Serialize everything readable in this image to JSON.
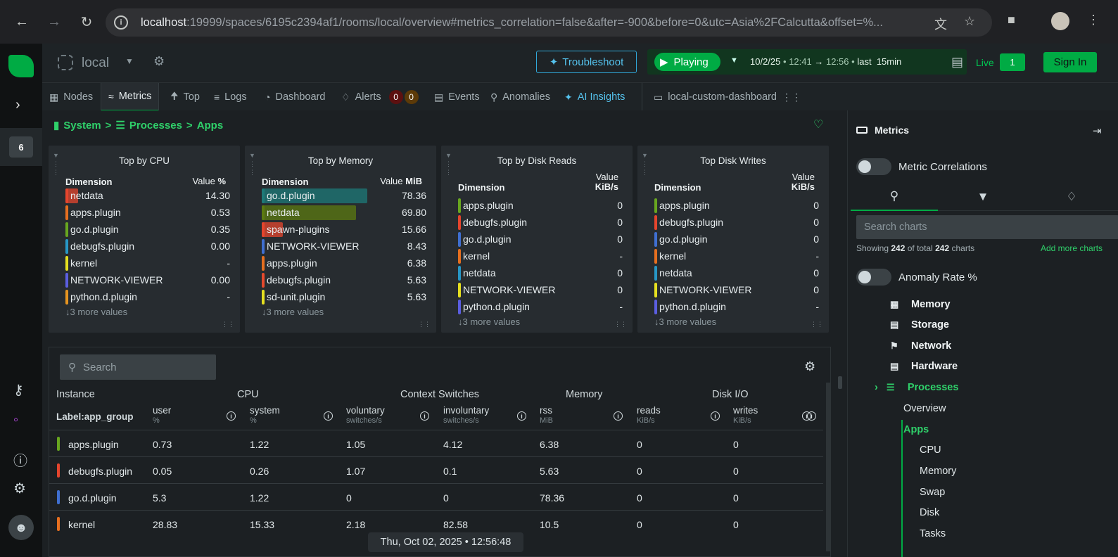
{
  "browser": {
    "url_host": "localhost",
    "url_rest": ":19999/spaces/6195c2394af1/rooms/local/overview#metrics_correlation=false&after=-900&before=0&utc=Asia%2FCalcutta&offset=%..."
  },
  "rail": {
    "badge": "6"
  },
  "header": {
    "space_name": "local",
    "troubleshoot": "Troubleshoot",
    "playing": "Playing",
    "range_date": "10/2/25",
    "range_from": "12:41",
    "range_to": "12:56",
    "range_last": "last",
    "range_dur": "15min",
    "live": "Live",
    "live_count": "1",
    "signin": "Sign In"
  },
  "tabs": [
    {
      "label": "Nodes"
    },
    {
      "label": "Metrics"
    },
    {
      "label": "Top"
    },
    {
      "label": "Logs"
    },
    {
      "label": "Dashboard"
    },
    {
      "label": "Alerts"
    },
    {
      "label": "Events"
    },
    {
      "label": "Anomalies"
    },
    {
      "label": "AI Insights"
    },
    {
      "label": "local-custom-dashboard"
    }
  ],
  "alerts": {
    "critical": "0",
    "warning": "0"
  },
  "breadcrumb": {
    "a": "System",
    "b": "Processes",
    "c": "Apps",
    "sep": ">"
  },
  "cards": [
    {
      "title": "Top by CPU",
      "dim": "Dimension",
      "val": "Value",
      "unit": "%",
      "more": "↓3 more values",
      "rows": [
        {
          "name": "netdata",
          "value": "14.30",
          "color": "#e5452d",
          "fill": 0.12
        },
        {
          "name": "apps.plugin",
          "value": "0.53",
          "color": "#e66f1f",
          "fill": 0
        },
        {
          "name": "go.d.plugin",
          "value": "0.35",
          "color": "#68a61f",
          "fill": 0
        },
        {
          "name": "debugfs.plugin",
          "value": "0.00",
          "color": "#2797c6",
          "fill": 0
        },
        {
          "name": "kernel",
          "value": "-",
          "color": "#e6e020",
          "fill": 0
        },
        {
          "name": "NETWORK-VIEWER",
          "value": "0.00",
          "color": "#5b5ee0",
          "fill": 0
        },
        {
          "name": "python.d.plugin",
          "value": "-",
          "color": "#e69420",
          "fill": 0
        }
      ]
    },
    {
      "title": "Top by Memory",
      "dim": "Dimension",
      "val": "Value",
      "unit": "MiB",
      "more": "↓3 more values",
      "rows": [
        {
          "name": "go.d.plugin",
          "value": "78.36",
          "color": "#1e7a78",
          "fill": 1.0
        },
        {
          "name": "netdata",
          "value": "69.80",
          "color": "#5c7a10",
          "fill": 0.89
        },
        {
          "name": "spawn-plugins",
          "value": "15.66",
          "color": "#e5452d",
          "fill": 0.2
        },
        {
          "name": "NETWORK-VIEWER",
          "value": "8.43",
          "color": "#3f6fd1",
          "fill": 0
        },
        {
          "name": "apps.plugin",
          "value": "6.38",
          "color": "#e66f1f",
          "fill": 0
        },
        {
          "name": "debugfs.plugin",
          "value": "5.63",
          "color": "#e64a2d",
          "fill": 0
        },
        {
          "name": "sd-unit.plugin",
          "value": "5.63",
          "color": "#e6e020",
          "fill": 0
        }
      ]
    },
    {
      "title": "Top by Disk Reads",
      "dim": "Dimension",
      "val": "Value",
      "unit": "KiB/s",
      "more": "↓3 more values",
      "rows": [
        {
          "name": "apps.plugin",
          "value": "0",
          "color": "#68a61f",
          "fill": 0
        },
        {
          "name": "debugfs.plugin",
          "value": "0",
          "color": "#e5452d",
          "fill": 0
        },
        {
          "name": "go.d.plugin",
          "value": "0",
          "color": "#3f6fd1",
          "fill": 0
        },
        {
          "name": "kernel",
          "value": "-",
          "color": "#e66f1f",
          "fill": 0
        },
        {
          "name": "netdata",
          "value": "0",
          "color": "#2797c6",
          "fill": 0
        },
        {
          "name": "NETWORK-VIEWER",
          "value": "0",
          "color": "#e6e020",
          "fill": 0
        },
        {
          "name": "python.d.plugin",
          "value": "-",
          "color": "#5b5ee0",
          "fill": 0
        }
      ]
    },
    {
      "title": "Top Disk Writes",
      "dim": "Dimension",
      "val": "Value",
      "unit": "KiB/s",
      "more": "↓3 more values",
      "rows": [
        {
          "name": "apps.plugin",
          "value": "0",
          "color": "#68a61f",
          "fill": 0
        },
        {
          "name": "debugfs.plugin",
          "value": "0",
          "color": "#e5452d",
          "fill": 0
        },
        {
          "name": "go.d.plugin",
          "value": "0",
          "color": "#3f6fd1",
          "fill": 0
        },
        {
          "name": "kernel",
          "value": "-",
          "color": "#e66f1f",
          "fill": 0
        },
        {
          "name": "netdata",
          "value": "0",
          "color": "#2797c6",
          "fill": 0
        },
        {
          "name": "NETWORK-VIEWER",
          "value": "0",
          "color": "#e6e020",
          "fill": 0
        },
        {
          "name": "python.d.plugin",
          "value": "-",
          "color": "#5b5ee0",
          "fill": 0
        }
      ]
    }
  ],
  "table": {
    "search_placeholder": "Search",
    "groups": [
      "Instance",
      "CPU",
      "Context Switches",
      "Memory",
      "Disk I/O"
    ],
    "label_col": "Label:app_group",
    "cols": [
      {
        "name": "user",
        "unit": "%"
      },
      {
        "name": "system",
        "unit": "%"
      },
      {
        "name": "voluntary",
        "unit": "switches/s"
      },
      {
        "name": "involuntary",
        "unit": "switches/s"
      },
      {
        "name": "rss",
        "unit": "MiB"
      },
      {
        "name": "reads",
        "unit": "KiB/s"
      },
      {
        "name": "writes",
        "unit": "KiB/s"
      }
    ],
    "rows": [
      {
        "name": "apps.plugin",
        "color": "#68a61f",
        "cells": [
          "0.73",
          "1.22",
          "1.05",
          "4.12",
          "6.38",
          "0",
          "0"
        ]
      },
      {
        "name": "debugfs.plugin",
        "color": "#e5452d",
        "cells": [
          "0.05",
          "0.26",
          "1.07",
          "0.1",
          "5.63",
          "0",
          "0"
        ]
      },
      {
        "name": "go.d.plugin",
        "color": "#3f6fd1",
        "cells": [
          "5.3",
          "1.22",
          "0",
          "0",
          "78.36",
          "0",
          "0"
        ]
      },
      {
        "name": "kernel",
        "color": "#e66f1f",
        "cells": [
          "28.83",
          "15.33",
          "2.18",
          "82.58",
          "10.5",
          "0",
          "0"
        ]
      }
    ]
  },
  "timestamp": "Thu, Oct 02, 2025 • 12:56:48",
  "right_panel": {
    "title": "Metrics",
    "metric_correlations": "Metric Correlations",
    "search_placeholder": "Search charts",
    "showing_pre": "Showing",
    "showing_n": "242",
    "showing_mid": "of total",
    "showing_total": "242",
    "showing_post": "charts",
    "add_more": "Add more charts",
    "anomaly_rate": "Anomaly Rate %",
    "sections": [
      "Memory",
      "Storage",
      "Network",
      "Hardware",
      "Processes"
    ],
    "sub": [
      "Overview",
      "Apps"
    ],
    "subsub": [
      "CPU",
      "Memory",
      "Swap",
      "Disk",
      "Tasks"
    ]
  }
}
